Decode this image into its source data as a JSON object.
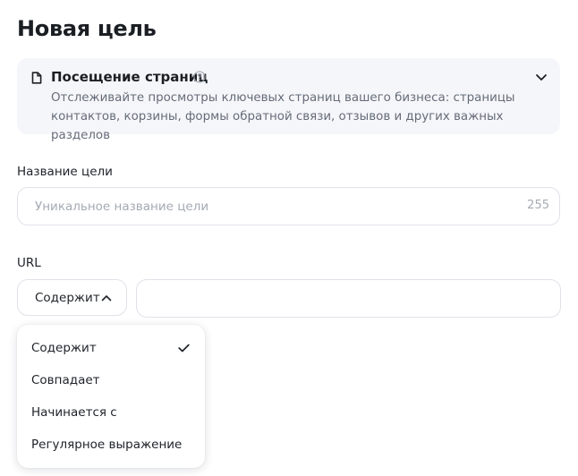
{
  "page": {
    "title": "Новая цель"
  },
  "goal_type": {
    "icon": "document-icon",
    "title": "Посещение страниц",
    "help_icon": "help-circle-icon",
    "expand_icon": "chevron-down-icon",
    "description": "Отслеживайте просмотры ключевых страниц вашего бизнеса: страницы контактов, корзины, формы обратной связи, отзывов и других важных разделов"
  },
  "goal_name": {
    "label": "Название цели",
    "placeholder": "Уникальное название цели",
    "value": "",
    "counter": "255"
  },
  "url": {
    "label": "URL",
    "condition_selected": "Содержит",
    "value": ""
  },
  "condition_dropdown": {
    "options": [
      {
        "label": "Содержит",
        "selected": true
      },
      {
        "label": "Совпадает",
        "selected": false
      },
      {
        "label": "Начинается с",
        "selected": false
      },
      {
        "label": "Регулярное выражение",
        "selected": false
      }
    ]
  },
  "colors": {
    "card_bg": "#f5f6fa",
    "border": "#dfe2e8",
    "text": "#1f2329",
    "muted": "#656c78",
    "placeholder": "#a5aab3"
  }
}
